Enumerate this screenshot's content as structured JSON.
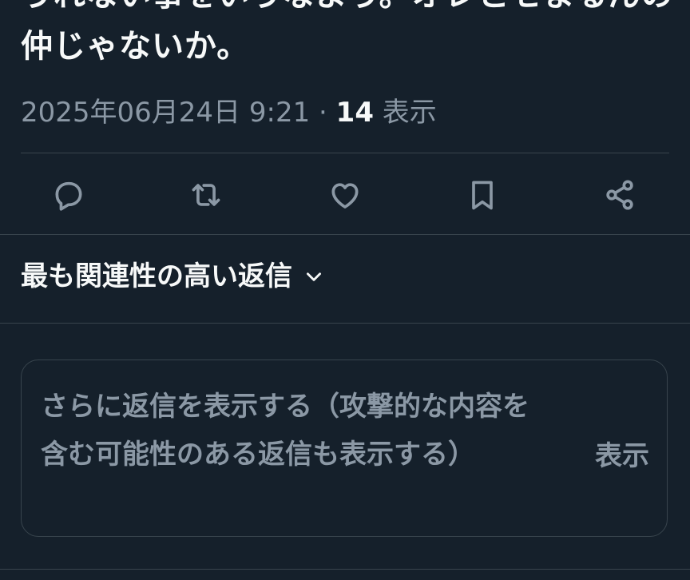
{
  "tweet": {
    "text": "うれない事をいうなよう。オレとセまるんの仲じゃないか。",
    "timestamp": "2025年06月24日 9:21",
    "separator": " · ",
    "views_count": "14",
    "views_label": " 表示"
  },
  "actions": [
    {
      "name": "reply",
      "icon": "reply-icon"
    },
    {
      "name": "retweet",
      "icon": "retweet-icon"
    },
    {
      "name": "like",
      "icon": "heart-icon"
    },
    {
      "name": "bookmark",
      "icon": "bookmark-icon"
    },
    {
      "name": "share",
      "icon": "share-icon"
    }
  ],
  "replies": {
    "sort_label": "最も関連性の高い返信",
    "more_text": "さらに返信を表示する（攻撃的な内容を含む可能性のある返信も表示する）",
    "show_button": "表示"
  },
  "colors": {
    "background": "#15202b",
    "text_primary": "#f7f9f9",
    "text_secondary": "#8b98a5",
    "border": "#38444d"
  }
}
